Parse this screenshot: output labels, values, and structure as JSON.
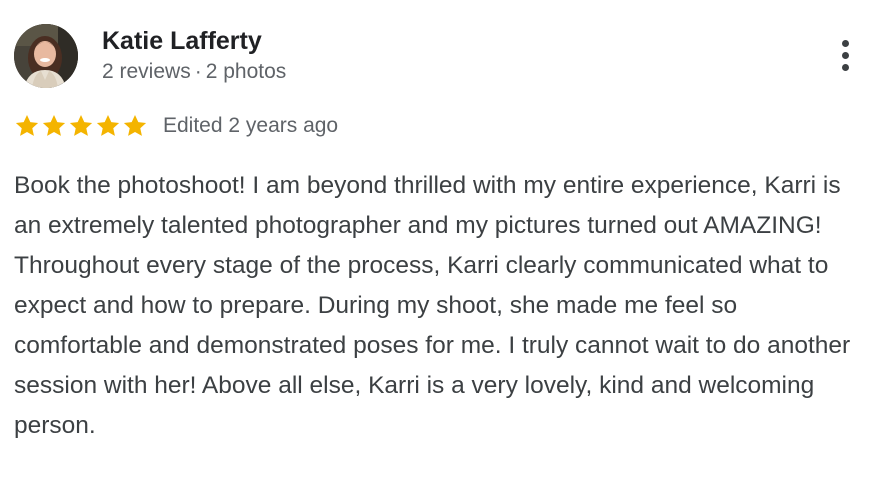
{
  "review": {
    "author": {
      "name": "Katie Lafferty",
      "reviews_count": "2 reviews",
      "separator": "·",
      "photos_count": "2 photos",
      "avatar_icon": "user-avatar-photo"
    },
    "rating": {
      "stars": 5,
      "max_stars": 5,
      "star_color": "#F4B400",
      "edited_label": "Edited 2 years ago"
    },
    "text": "Book the photoshoot! I am beyond thrilled with my entire experience, Karri is an extremely talented photographer and my pictures turned out AMAZING! Throughout every stage of the process, Karri clearly communicated what to expect and how to prepare. During my shoot, she made me feel so comfortable and demonstrated poses for me. I truly cannot wait to do another session with her! Above all else, Karri is a very lovely, kind and welcoming person.",
    "menu_icon": "more-vertical-icon"
  }
}
